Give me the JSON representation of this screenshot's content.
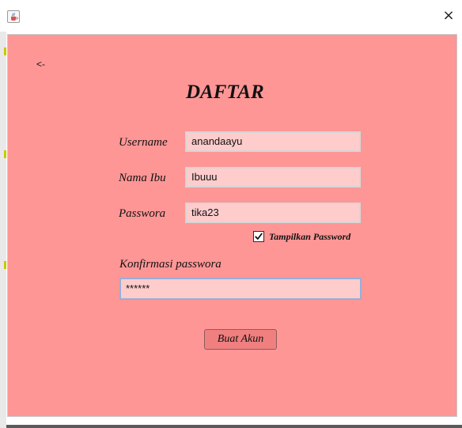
{
  "window": {
    "icon": "java-cup-icon",
    "close_label": "×"
  },
  "nav": {
    "back_label": "<-"
  },
  "form": {
    "title": "DAFTAR",
    "username_label": "Username",
    "username_value": "anandaayu",
    "mother_name_label": "Nama Ibu",
    "mother_name_value": "Ibuuu",
    "password_label": "Passwora",
    "password_value": "tika23",
    "show_password_label": "Tampilkan Password",
    "show_password_checked": true,
    "confirm_label": "Konfirmasi passwora",
    "confirm_value": "******",
    "submit_label": "Buat Akun"
  },
  "colors": {
    "panel_bg": "#ff9696",
    "field_bg": "#ffcccc",
    "button_bg": "#f07f7f"
  }
}
